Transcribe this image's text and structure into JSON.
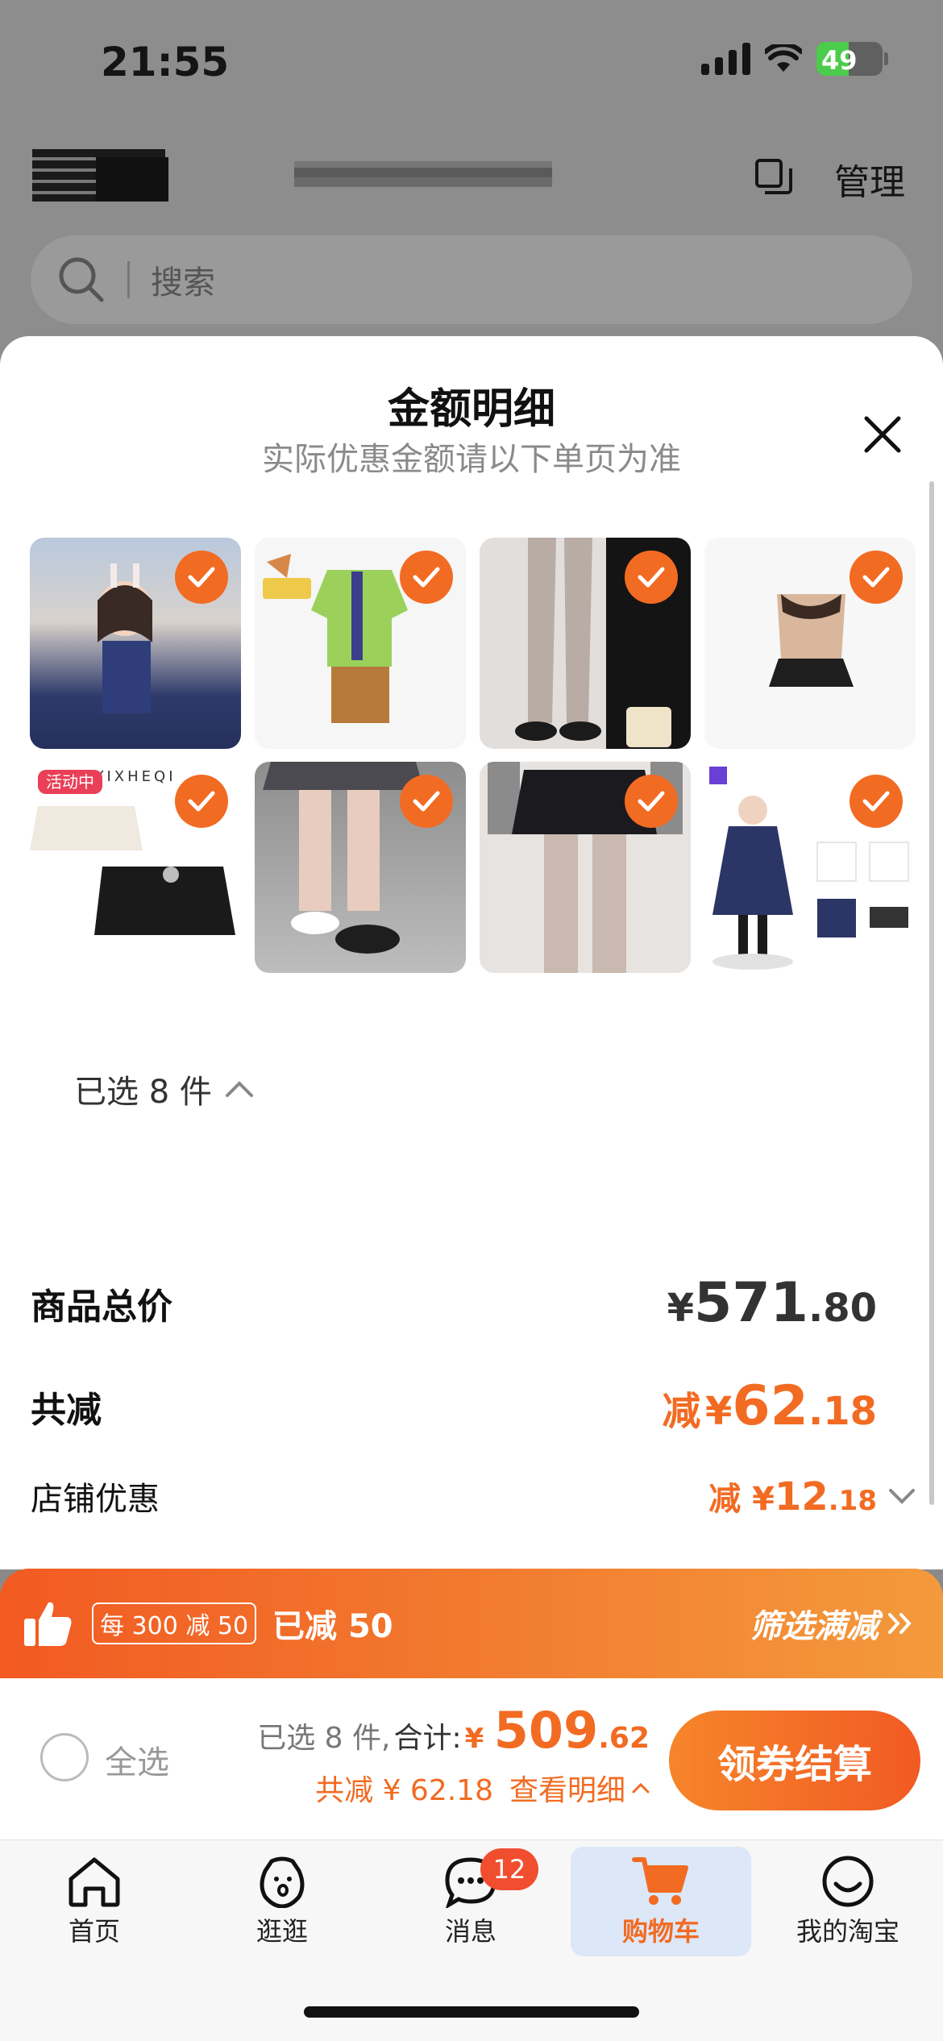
{
  "status_bar": {
    "time": "21:55",
    "battery": "49"
  },
  "background": {
    "manage_label": "管理",
    "search_placeholder": "搜索"
  },
  "sheet": {
    "title": "金额明细",
    "subtitle": "实际优惠金额请以下单页为准",
    "products": [
      {
        "name": "product-1",
        "checked": true
      },
      {
        "name": "product-2",
        "checked": true
      },
      {
        "name": "product-3",
        "checked": true
      },
      {
        "name": "product-4",
        "checked": true
      },
      {
        "name": "product-5",
        "checked": true,
        "badge": "活动中",
        "brand": "YIXHEQI"
      },
      {
        "name": "product-6",
        "checked": true
      },
      {
        "name": "product-7",
        "checked": true
      },
      {
        "name": "product-8",
        "checked": true
      }
    ],
    "selected_count": "已选 8 件",
    "total_price": {
      "label": "商品总价",
      "currency": "¥",
      "integer": "571",
      "decimal": ".80"
    },
    "total_discount": {
      "label": "共减",
      "prefix": "减",
      "currency": "¥",
      "integer": "62",
      "decimal": ".18"
    },
    "shop_discount": {
      "label": "店铺优惠",
      "prefix": "减",
      "currency": "¥",
      "integer": "12",
      "decimal": ".18"
    }
  },
  "promo": {
    "tag": "每 300 减 50",
    "applied": "已减 50",
    "filter": "筛选满减"
  },
  "checkout": {
    "select_all": "全选",
    "selected": "已选 8 件,",
    "sum_label": "合计:",
    "currency": "¥",
    "integer": "509",
    "decimal": ".62",
    "discount_text": "共减 ¥ 62.18",
    "detail_link": "查看明细",
    "pay_button": "领券结算"
  },
  "tabbar": {
    "items": [
      {
        "label": "首页",
        "icon": "home-icon"
      },
      {
        "label": "逛逛",
        "icon": "explore-icon"
      },
      {
        "label": "消息",
        "icon": "message-icon",
        "badge": "12"
      },
      {
        "label": "购物车",
        "icon": "cart-icon",
        "active": true
      },
      {
        "label": "我的淘宝",
        "icon": "profile-icon"
      }
    ]
  },
  "colors": {
    "accent": "#f26b22",
    "badge_red": "#f04e2e",
    "active_tab_bg": "#dce7f7"
  }
}
